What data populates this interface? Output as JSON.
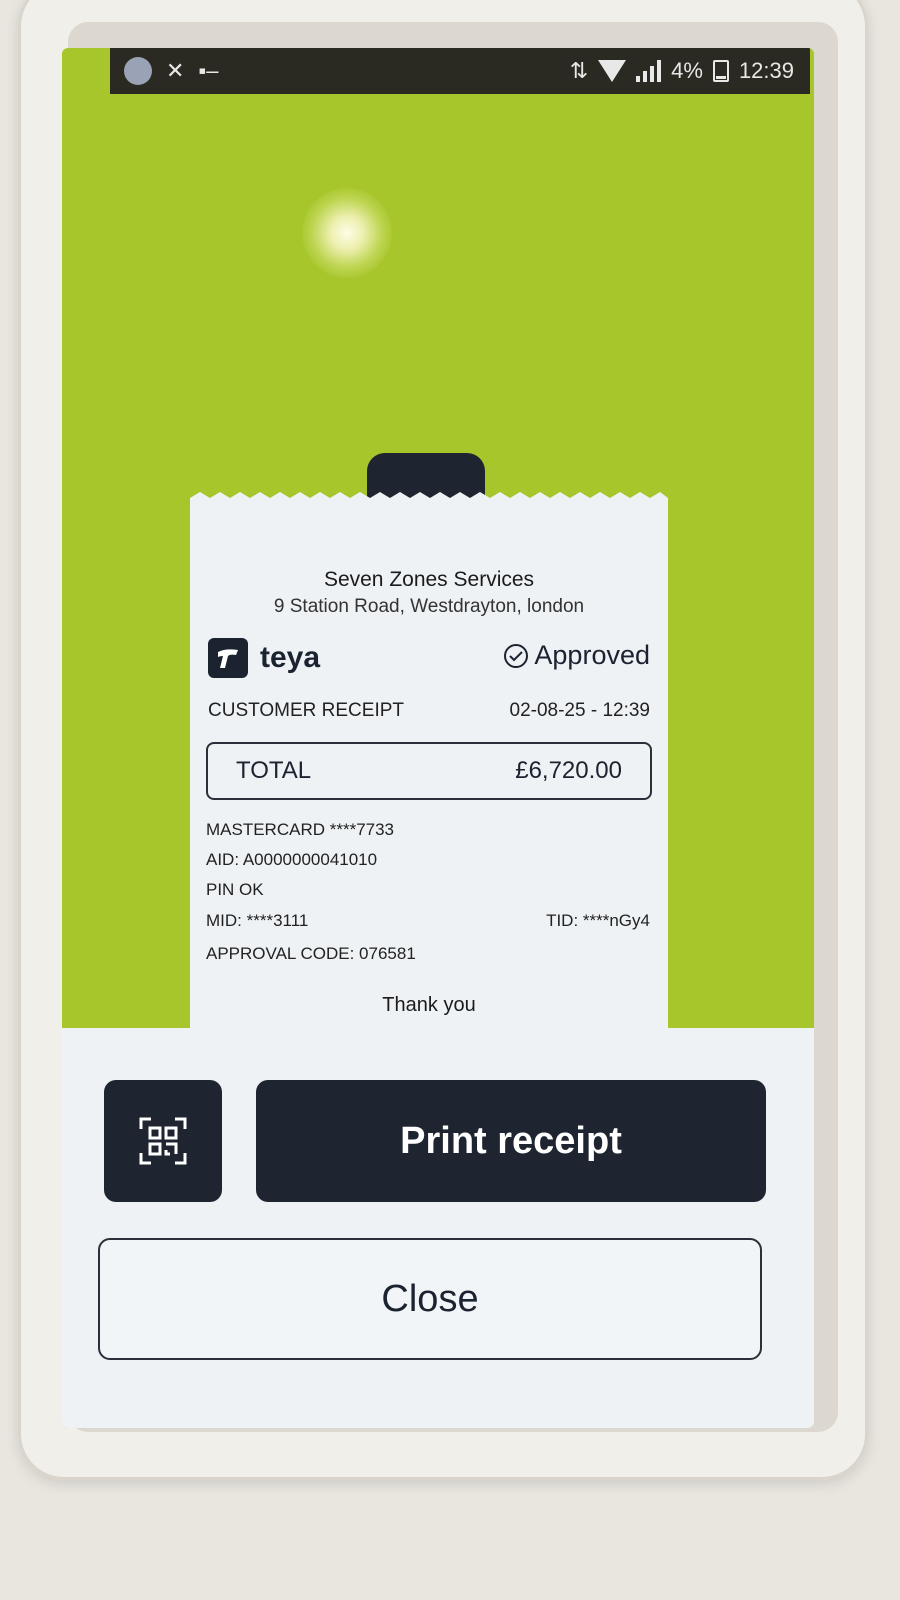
{
  "status_bar": {
    "battery": "4%",
    "time": "12:39"
  },
  "receipt": {
    "merchant_name": "Seven Zones Services",
    "merchant_address": "9 Station Road, Westdrayton, london",
    "brand": "teya",
    "status": "Approved",
    "receipt_type": "CUSTOMER RECEIPT",
    "datetime": "02-08-25 - 12:39",
    "total_label": "TOTAL",
    "total_value": "£6,720.00",
    "card": "MASTERCARD ****7733",
    "aid": "AID: A0000000041010",
    "pin": "PIN OK",
    "mid": "MID: ****3111",
    "tid": "TID: ****nGy4",
    "approval_code": "APPROVAL CODE: 076581",
    "thanks": "Thank you"
  },
  "actions": {
    "qr_icon": "qr-code-icon",
    "print_label": "Print receipt",
    "close_label": "Close"
  },
  "colors": {
    "background_green": "#a7c62b",
    "dark_navy": "#1e2430",
    "receipt_bg": "#eef2f5"
  }
}
